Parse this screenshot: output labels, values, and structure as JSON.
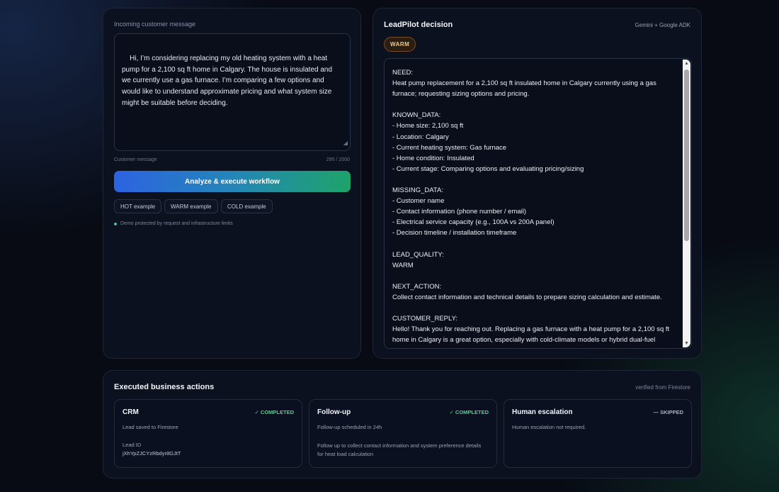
{
  "input": {
    "label": "Incoming customer message",
    "message": "Hi, I’m considering replacing my old heating system with a heat pump for a 2,100 sq ft home in Calgary. The house is insulated and we currently use a gas furnace. I’m comparing a few options and would like to understand approximate pricing and what system size might be suitable before deciding.",
    "caption": "Customer message",
    "char_count": "295 / 2000",
    "analyze_label": "Analyze & execute workflow",
    "examples": [
      "HOT example",
      "WARM example",
      "COLD example"
    ],
    "demo_note": "Demo protected by request and infrastructure limits"
  },
  "decision": {
    "title": "LeadPilot decision",
    "engine": "Gemini + Google ADK",
    "lead_quality_badge": "WARM",
    "output_text": "NEED:\nHeat pump replacement for a 2,100 sq ft insulated home in Calgary currently using a gas furnace; requesting sizing options and pricing.\n\nKNOWN_DATA:\n- Home size: 2,100 sq ft\n- Location: Calgary\n- Current heating system: Gas furnace\n- Home condition: Insulated\n- Current stage: Comparing options and evaluating pricing/sizing\n\nMISSING_DATA:\n- Customer name\n- Contact information (phone number / email)\n- Electrical service capacity (e.g., 100A vs 200A panel)\n- Decision timeline / installation timeframe\n\nLEAD_QUALITY:\nWARM\n\nNEXT_ACTION:\nCollect contact information and technical details to prepare sizing calculation and estimate.\n\nCUSTOMER_REPLY:\nHello! Thank you for reaching out. Replacing a gas furnace with a heat pump for a 2,100 sq ft home in Calgary is a great option, especially with cold-climate models or hybrid dual-fuel"
  },
  "actions": {
    "title": "Executed business actions",
    "verified": "verified from Firestore",
    "cards": [
      {
        "title": "CRM",
        "status": "✓ COMPLETED",
        "description": "Lead saved to Firestore",
        "sub_label": "Lead ID",
        "sub_value": "jXhYpZJCYzRbdyr8GJtT"
      },
      {
        "title": "Follow-up",
        "status": "✓ COMPLETED",
        "description": "Follow-up scheduled in 24h",
        "note": "Follow up to collect contact information and system preference details for heat load calculation"
      },
      {
        "title": "Human escalation",
        "status": "— SKIPPED",
        "description": "Human escalation not required."
      }
    ]
  },
  "colors": {
    "accent_blue": "#2d63e2",
    "accent_green": "#1ea36a",
    "completed": "#4ad38d",
    "warm_badge": "#f1c88c"
  }
}
